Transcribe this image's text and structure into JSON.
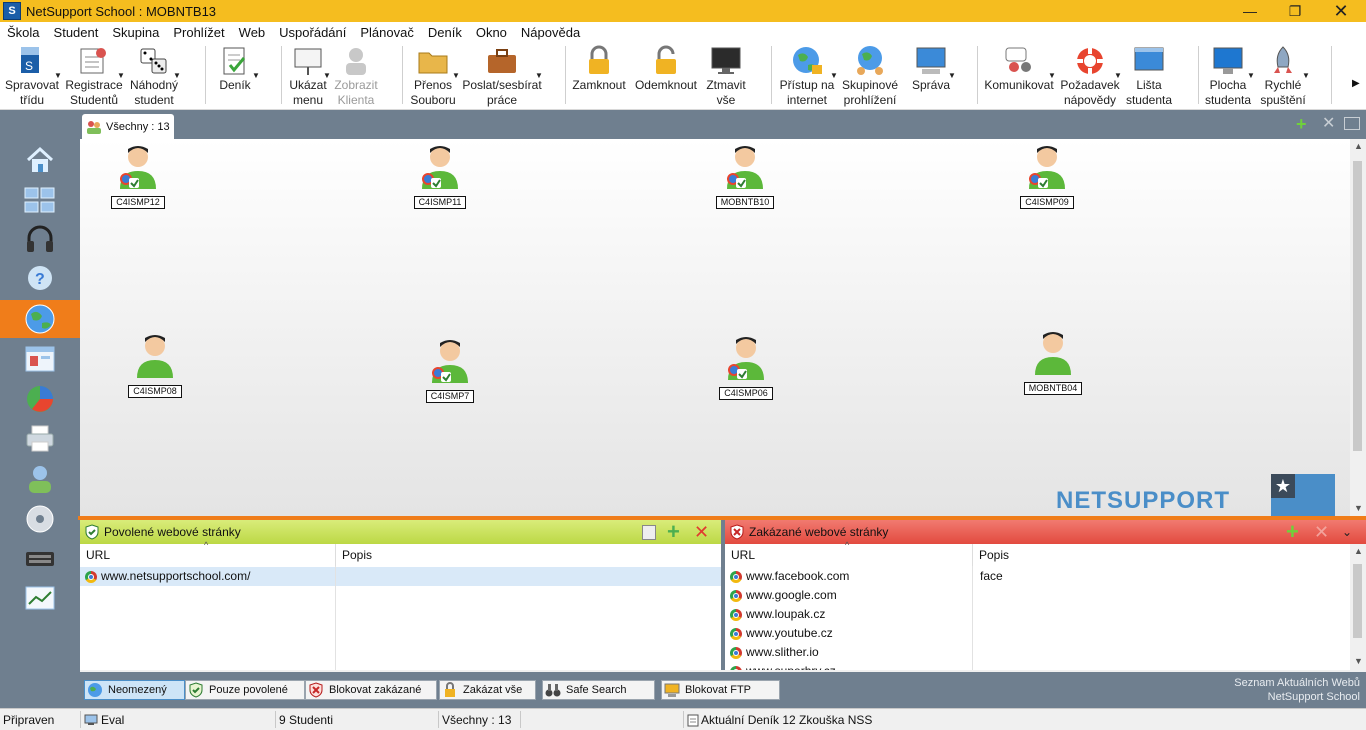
{
  "window": {
    "title": "NetSupport School : MOBNTB13",
    "app_icon": "S"
  },
  "menu": [
    "Škola",
    "Student",
    "Skupina",
    "Prohlížet",
    "Web",
    "Uspořádání",
    "Plánovač",
    "Deník",
    "Okno",
    "Nápověda"
  ],
  "toolbar": {
    "manage_class": [
      "Spravovat",
      "třídu"
    ],
    "registration": [
      "Registrace",
      "Studentů"
    ],
    "random_student": [
      "Náhodný",
      "student"
    ],
    "journal": [
      "Deník"
    ],
    "show_menu": [
      "Ukázat",
      "menu"
    ],
    "show_client": [
      "Zobrazit",
      "Klienta"
    ],
    "file_transfer": [
      "Přenos",
      "Souboru"
    ],
    "send_collect": [
      "Poslat/sesbírat",
      "práce"
    ],
    "lock": [
      "Zamknout"
    ],
    "unlock": [
      "Odemknout"
    ],
    "blank_all": [
      "Ztmavit",
      "vše"
    ],
    "internet_access": [
      "Přístup na",
      "internet"
    ],
    "group_browsing": [
      "Skupinové",
      "prohlížení"
    ],
    "manage": [
      "Správa"
    ],
    "communicate": [
      "Komunikovat"
    ],
    "help_request": [
      "Požadavek",
      "nápovědy"
    ],
    "student_bar": [
      "Lišta",
      "studenta"
    ],
    "student_desktop": [
      "Plocha",
      "studenta"
    ],
    "quick_launch": [
      "Rychlé",
      "spuštění"
    ],
    "more_arrow": "▶"
  },
  "tab": {
    "label": "Všechny : 13"
  },
  "students": [
    {
      "name": "C4ISMP12",
      "browser": true
    },
    {
      "name": "C4ISMP11",
      "browser": true
    },
    {
      "name": "MOBNTB10",
      "browser": true
    },
    {
      "name": "C4ISMP09",
      "browser": true
    },
    {
      "name": "C4ISMP08",
      "browser": false
    },
    {
      "name": "C4ISMP7",
      "browser": true
    },
    {
      "name": "C4ISMP06",
      "browser": true
    },
    {
      "name": "MOBNTB04",
      "browser": false
    }
  ],
  "logo_text": "NETSUPPORT",
  "approved": {
    "title": "Povolené webové stránky",
    "col_url": "URL",
    "col_desc": "Popis",
    "rows": [
      {
        "url": "www.netsupportschool.com/",
        "desc": ""
      }
    ]
  },
  "restricted": {
    "title": "Zakázané webové stránky",
    "col_url": "URL",
    "col_desc": "Popis",
    "rows": [
      {
        "url": "www.facebook.com",
        "desc": "face"
      },
      {
        "url": "www.google.com",
        "desc": ""
      },
      {
        "url": "www.loupak.cz",
        "desc": ""
      },
      {
        "url": "www.youtube.cz",
        "desc": ""
      },
      {
        "url": "www.slither.io",
        "desc": ""
      },
      {
        "url": "www.superhry.cz",
        "desc": ""
      }
    ]
  },
  "bottom_buttons": {
    "unrestricted": "Neomezený",
    "approved_only": "Pouze povolené",
    "block_restricted": "Blokovat zakázané",
    "block_all": "Zakázat vše",
    "safe_search": "Safe Search",
    "block_ftp": "Blokovat FTP"
  },
  "bottom_right": {
    "line1": "Seznam Aktuálních Webů",
    "line2": "NetSupport School"
  },
  "status": {
    "ready": "Připraven",
    "eval": "Eval",
    "students": "9 Studenti",
    "all": "Všechny : 13",
    "journal": "Aktuální Deník 12 Zkouška NSS"
  },
  "colors": {
    "title_bar": "#f5bd1f",
    "sidebar": "#6f7f8f",
    "accent_orange": "#f07d1a",
    "approved_header": "#c4dd4c",
    "restricted_header": "#e9584f"
  }
}
